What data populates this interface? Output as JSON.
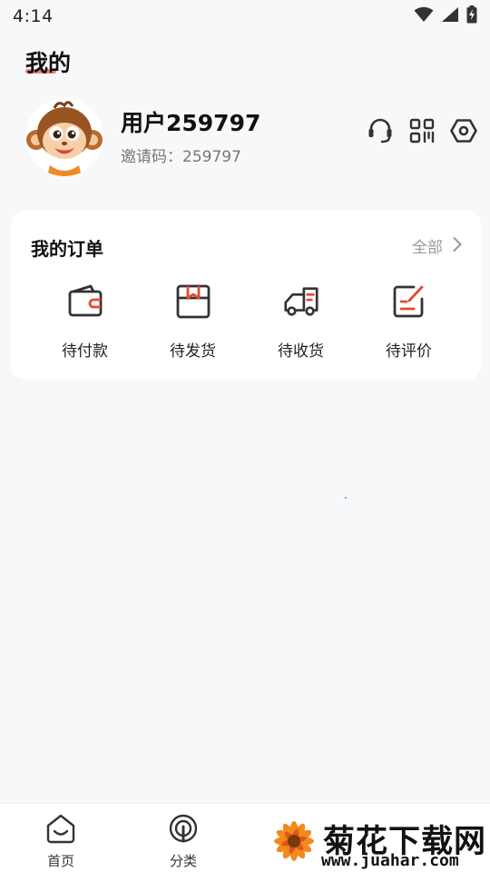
{
  "status_bar": {
    "time": "4:14",
    "icons": [
      "wifi-icon",
      "cellular-signal-icon",
      "battery-charging-icon"
    ]
  },
  "page": {
    "title": "我的",
    "accent_color": "#f26a6a"
  },
  "profile": {
    "avatar_icon": "monkey-avatar",
    "username": "用户259797",
    "invite_label": "邀请码：",
    "invite_code": "259797",
    "actions": [
      "customer-service-icon",
      "qr-code-icon",
      "settings-icon"
    ]
  },
  "orders": {
    "title": "我的订单",
    "all_label": "全部",
    "items": [
      {
        "label": "待付款",
        "icon": "wallet-icon"
      },
      {
        "label": "待发货",
        "icon": "package-icon"
      },
      {
        "label": "待收货",
        "icon": "truck-icon"
      },
      {
        "label": "待评价",
        "icon": "review-edit-icon"
      }
    ]
  },
  "tab_bar": {
    "items": [
      {
        "label": "首页",
        "icon": "home-icon"
      },
      {
        "label": "分类",
        "icon": "category-icon"
      }
    ]
  },
  "watermark": {
    "title": "菊花下载网",
    "url": "www.juahar.com"
  }
}
